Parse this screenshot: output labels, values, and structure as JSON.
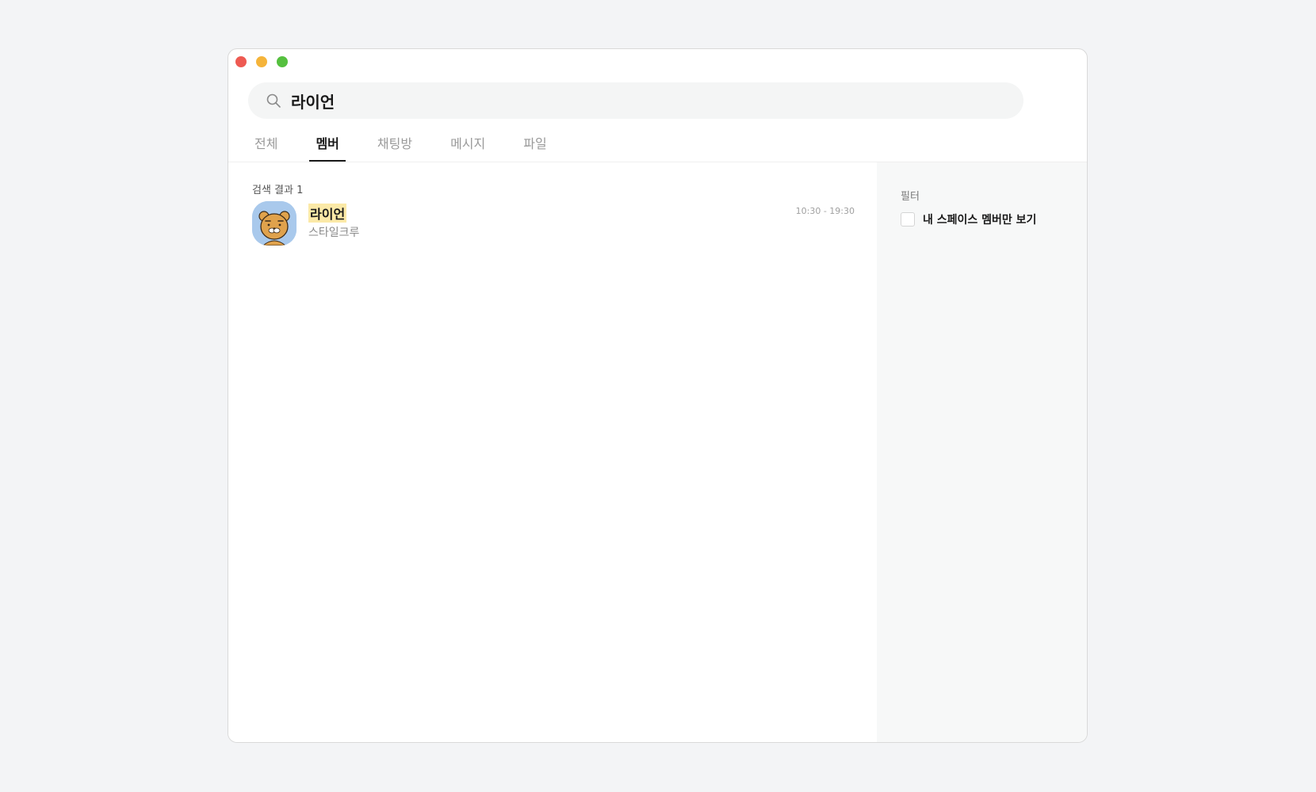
{
  "window_controls": {
    "close_color": "#ee5a52",
    "minimize_color": "#f5b43a",
    "maximize_color": "#55c03f"
  },
  "search": {
    "value": "라이언",
    "icon": "search-icon"
  },
  "tabs": [
    {
      "label": "전체",
      "active": false
    },
    {
      "label": "멤버",
      "active": true
    },
    {
      "label": "채팅방",
      "active": false
    },
    {
      "label": "메시지",
      "active": false
    },
    {
      "label": "파일",
      "active": false
    }
  ],
  "results": {
    "count_label": "검색 결과 1",
    "items": [
      {
        "name": "라이언",
        "team": "스타일크루",
        "hours": "10:30 - 19:30",
        "avatar": "lion-character-avatar",
        "highlight_color": "#fbe9a7"
      }
    ]
  },
  "filter": {
    "title": "필터",
    "option_label": "내 스페이스 멤버만 보기",
    "option_checked": false
  }
}
